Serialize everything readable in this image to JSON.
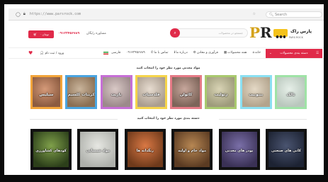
{
  "browser": {
    "url": "https://www.parsrock.com",
    "search_label": "Search"
  },
  "header": {
    "cart_label": "۰ تومان",
    "phone": "۰۹۱۲۳۴۵۶۷۸۹",
    "consult_text": "مشاوره رایگان",
    "search_placeholder": "جستجو در محصولات",
    "logo_letters": "PR",
    "logo_name": "پارس راک",
    "logo_sub": "PARS ROCK"
  },
  "nav": {
    "categories_label": "دسته بندی محصولات",
    "items": [
      "خانه",
      "همه محصولات",
      "فرآوری و معادن",
      "درباره ما",
      "تماس با ما"
    ],
    "phone_short": "۰۹۱۲۳۴۵۶۷۸۹",
    "lang": "فارسی",
    "login": "ورود / ثبت نام"
  },
  "section1": {
    "title": "مواد معدنی مورد نظر خود را انتخاب کنید",
    "tiles": [
      {
        "label": "تالک",
        "border": "#9fe3a6",
        "bg1": "#e6efe8",
        "bg2": "#b9c7bd"
      },
      {
        "label": "بنتونیت",
        "border": "#8be0f2",
        "bg1": "#e4d9c6",
        "bg2": "#b3a48d"
      },
      {
        "label": "زئولیت",
        "border": "#a9c96e",
        "bg1": "#d9d4b5",
        "bg2": "#9e9b7b"
      },
      {
        "label": "کائولن",
        "border": "#e57a86",
        "bg1": "#c7a79c",
        "bg2": "#7d6459"
      },
      {
        "label": "فلدسپات",
        "border": "#f5d44b",
        "bg1": "#e7dcd0",
        "bg2": "#aa9d8f"
      },
      {
        "label": "باریت",
        "border": "#c66fd6",
        "bg1": "#d9c9c6",
        "bg2": "#9c8a8b"
      },
      {
        "label": "کربنات کلسیم",
        "border": "#4aa4e0",
        "bg1": "#c9b49b",
        "bg2": "#8b6f53"
      },
      {
        "label": "سیلیس",
        "border": "#f2a43a",
        "bg1": "#d59a79",
        "bg2": "#8c5b40"
      }
    ]
  },
  "section2": {
    "title": "دسته بندی مورد نظر خود را انتخاب کنید",
    "tiles": [
      {
        "label": "کانی های صنعتی",
        "bg1": "#4a5470",
        "bg2": "#1d2333"
      },
      {
        "label": "پودر های معدنی",
        "bg1": "#7a6fa8",
        "bg2": "#3a3155"
      },
      {
        "label": "مواد خام و اولیه",
        "bg1": "#b78753",
        "bg2": "#5b3b22"
      },
      {
        "label": "رنگدانه ها",
        "bg1": "#d97844",
        "bg2": "#6f3a1b"
      },
      {
        "label": "مواد شیمیایی",
        "bg1": "#e6e7e2",
        "bg2": "#aeb0ab"
      },
      {
        "label": "کودهای کشاورزی",
        "bg1": "#7fa04a",
        "bg2": "#2c3f1a"
      }
    ]
  }
}
